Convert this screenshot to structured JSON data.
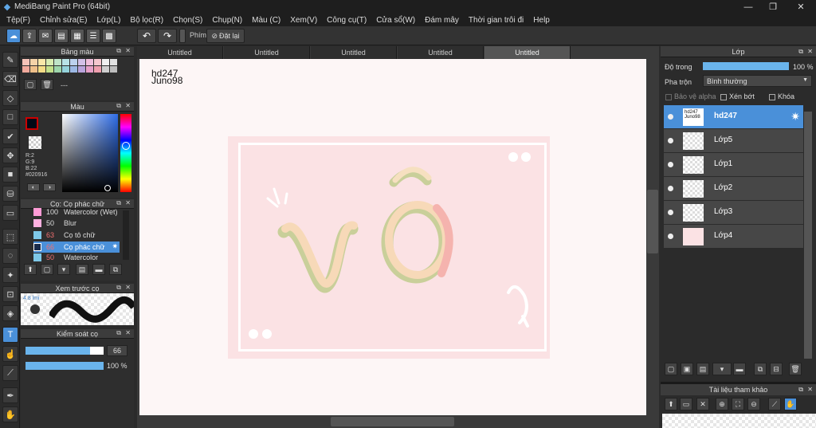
{
  "app": {
    "title": "MediBang Paint Pro (64bit)"
  },
  "menu": [
    "Tệp(F)",
    "Chỉnh sửa(E)",
    "Lớp(L)",
    "Bộ lọc(R)",
    "Chọn(S)",
    "Chụp(N)",
    "Màu (C)",
    "Xem(V)",
    "Công cụ(T)",
    "Cửa sổ(W)",
    "Đám mây",
    "Thời gian trôi đi",
    "Help"
  ],
  "toolbar": {
    "key_label": "Phím",
    "reset_label": "Đặt lại"
  },
  "palette_panel": {
    "title": "Bảng màu",
    "placeholder": "---"
  },
  "color_panel": {
    "title": "Màu",
    "r": "R:2",
    "g": "G:9",
    "b": "B:22",
    "hex": "#020916",
    "primary": "#020916"
  },
  "brush_panel": {
    "title": "Cọ: Cọ phác chữ",
    "brushes": [
      {
        "size": "100",
        "name": "Watercolor (Wet)",
        "color": "#ff9bd6"
      },
      {
        "size": "50",
        "name": "Blur",
        "color": "#ffb0e0"
      },
      {
        "size": "63",
        "name": "Cọ tô chữ",
        "color": "#7ec8e8"
      },
      {
        "size": "66",
        "name": "Cọ phác chữ",
        "color": "#1a2b4a"
      },
      {
        "size": "50",
        "name": "Watercolor",
        "color": "#7ec8e8"
      }
    ]
  },
  "preview_panel": {
    "title": "Xem trước cọ",
    "size": "4.8 lmi"
  },
  "brush_control": {
    "title": "Kiểm soát cọ",
    "size_value": "66",
    "opacity_value": "100 %",
    "size_fraction": 0.83,
    "opacity_fraction": 1.0
  },
  "tabs": [
    "Untitled",
    "Untitled",
    "Untitled",
    "Untitled",
    "Untitled"
  ],
  "canvas": {
    "text_line1": "hd247",
    "text_line2": "Juno98",
    "card_text": "vô"
  },
  "layer_panel": {
    "title": "Lớp",
    "opacity_label": "Độ trong",
    "opacity_value": "100 %",
    "opacity_fraction": 1.0,
    "blend_label": "Pha trộn",
    "blend_value": "Bình thường",
    "protect_alpha": "Bảo vệ alpha",
    "clip": "Xén bớt",
    "lock": "Khóa",
    "layers": [
      {
        "name": "hd247",
        "thumb": "hd247 Juno98"
      },
      {
        "name": "Lớp5"
      },
      {
        "name": "Lớp1"
      },
      {
        "name": "Lớp2"
      },
      {
        "name": "Lớp3"
      },
      {
        "name": "Lớp4"
      }
    ]
  },
  "reference_panel": {
    "title": "Tài liệu tham khảo"
  },
  "icons": {
    "app": "medibang-icon",
    "gear": "gear-icon"
  }
}
